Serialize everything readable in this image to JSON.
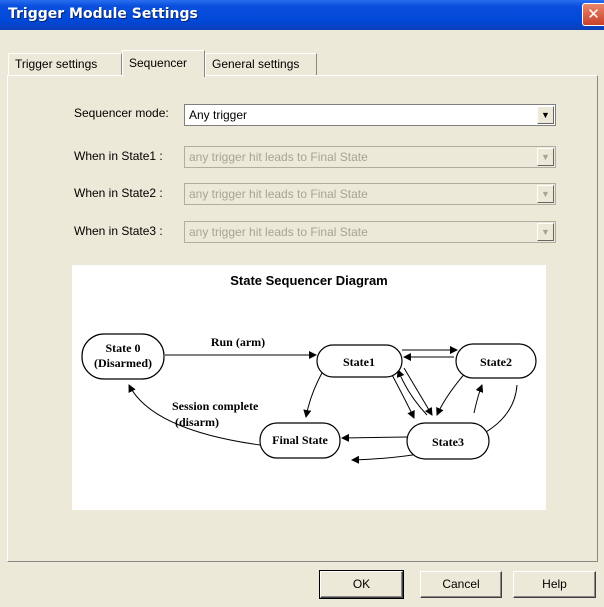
{
  "window": {
    "title": "Trigger Module Settings",
    "close_glyph": "✕"
  },
  "tabs": [
    {
      "label": "Trigger settings",
      "active": false
    },
    {
      "label": "Sequencer",
      "active": true
    },
    {
      "label": "General settings",
      "active": false
    }
  ],
  "sequencer": {
    "mode_label": "Sequencer mode:",
    "mode_value": "Any trigger",
    "state_rows": [
      {
        "label": "When in State1 :",
        "value": "any trigger hit leads to Final State"
      },
      {
        "label": "When in State2 :",
        "value": "any trigger hit leads to Final State"
      },
      {
        "label": "When in State3 :",
        "value": "any trigger hit leads to Final State"
      }
    ]
  },
  "diagram": {
    "title": "State Sequencer Diagram",
    "state0_line1": "State 0",
    "state0_line2": "(Disarmed)",
    "state1": "State1",
    "state2": "State2",
    "state3": "State3",
    "final_state": "Final State",
    "run_label": "Run (arm)",
    "complete_line1": "Session complete",
    "complete_line2": "(disarm)"
  },
  "buttons": {
    "ok": "OK",
    "cancel": "Cancel",
    "help": "Help"
  },
  "icons": {
    "dropdown": "chevron-down-icon",
    "close": "close-icon"
  }
}
